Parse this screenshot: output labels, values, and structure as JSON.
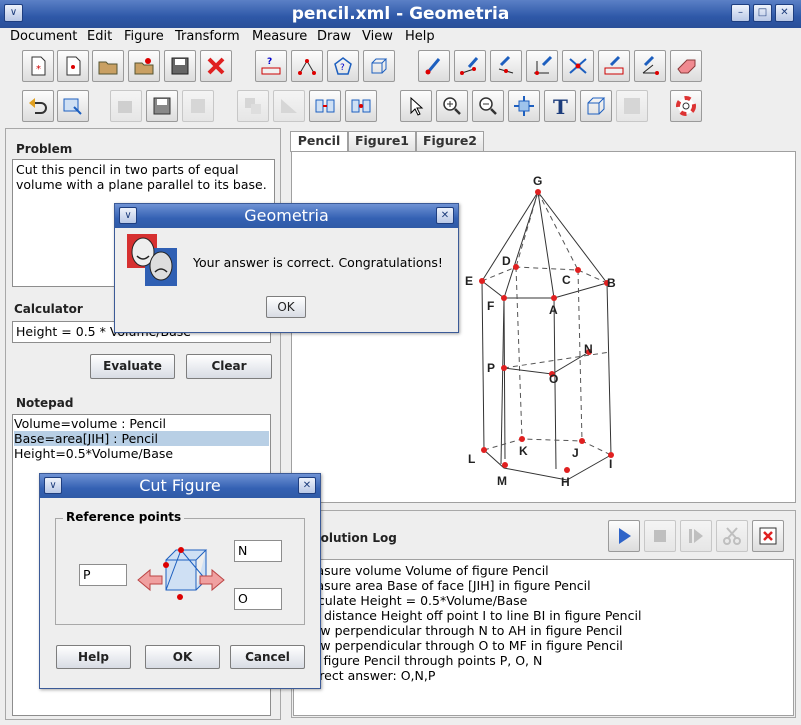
{
  "window": {
    "title": "pencil.xml - Geometria"
  },
  "menu": [
    "Document",
    "Edit",
    "Figure",
    "Transform",
    "Measure",
    "Draw",
    "View",
    "Help"
  ],
  "left": {
    "problem_label": "Problem",
    "problem_text": "Cut this pencil in two parts of equal volume with a plane parallel to its base.",
    "calculator_label": "Calculator",
    "calculator_value": "Height = 0.5 * Volume/Base",
    "evaluate_label": "Evaluate",
    "clear_label": "Clear",
    "notepad_label": "Notepad",
    "notepad_lines": [
      "Volume=volume : Pencil",
      "Base=area[JIH] : Pencil",
      "Height=0.5*Volume/Base"
    ]
  },
  "tabs": [
    "Pencil",
    "Figure1",
    "Figure2"
  ],
  "figure_labels": [
    "G",
    "D",
    "C",
    "E",
    "B",
    "F",
    "A",
    "P",
    "N",
    "O",
    "K",
    "J",
    "L",
    "I",
    "M",
    "H"
  ],
  "log": {
    "label": "Solution Log",
    "lines": [
      "Measure volume Volume of figure Pencil",
      "Measure area Base of face [JIH] in figure Pencil",
      "Calculate Height = 0.5*Volume/Base",
      "Lay distance Height off point I to line BI in figure Pencil",
      "Draw perpendicular through N to AH in figure Pencil",
      "Draw perpendicular through O to MF in figure Pencil",
      "Cut figure Pencil through points P, O, N",
      "Correct answer: O,N,P"
    ]
  },
  "congrats_dialog": {
    "title": "Geometria",
    "message": "Your answer is correct. Congratulations!",
    "ok_label": "OK"
  },
  "cut_dialog": {
    "title": "Cut Figure",
    "group_label": "Reference points",
    "point1": "P",
    "point2": "N",
    "point3": "O",
    "help_label": "Help",
    "ok_label": "OK",
    "cancel_label": "Cancel"
  },
  "colors": {
    "titlebar": "#2e58a8",
    "accent_red": "#e02020",
    "selection": "#b8cfe5"
  }
}
